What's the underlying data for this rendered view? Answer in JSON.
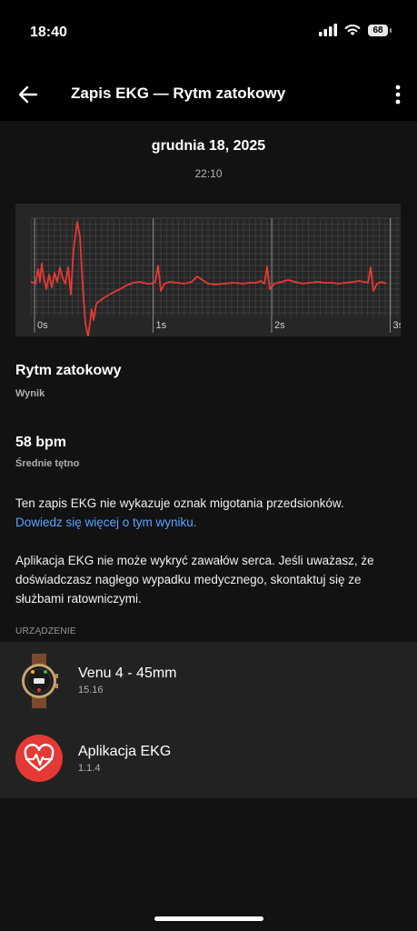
{
  "status": {
    "time": "18:40",
    "battery": "68"
  },
  "header": {
    "title": "Zapis EKG — Rytm zatokowy"
  },
  "record": {
    "date": "grudnia 18, 2025",
    "time": "22:10"
  },
  "chart_data": {
    "type": "line",
    "x_ticks": [
      "0s",
      "1s",
      "2s",
      "3s"
    ],
    "xlim": [
      0,
      3
    ],
    "grid": true,
    "series_color": "#e53935"
  },
  "result": {
    "value": "Rytm zatokowy",
    "label": "Wynik"
  },
  "heart_rate": {
    "value": "58 bpm",
    "label": "Średnie tętno"
  },
  "info": {
    "text": "Ten zapis EKG nie wykazuje oznak migotania przedsionków.",
    "link": "Dowiedz się więcej o tym wyniku.",
    "warning": "Aplikacja EKG nie może wykryć zawałów serca. Jeśli uważasz, że doświadczasz nagłego wypadku medycznego, skontaktuj się ze służbami ratowniczymi."
  },
  "device_section": {
    "label": "URZĄDZENIE",
    "items": [
      {
        "name": "Venu 4 - 45mm",
        "version": "15.16"
      },
      {
        "name": "Aplikacja EKG",
        "version": "1.1.4"
      }
    ]
  },
  "colors": {
    "accent": "#e53935",
    "link": "#5aa4ff",
    "background": "#121212"
  }
}
